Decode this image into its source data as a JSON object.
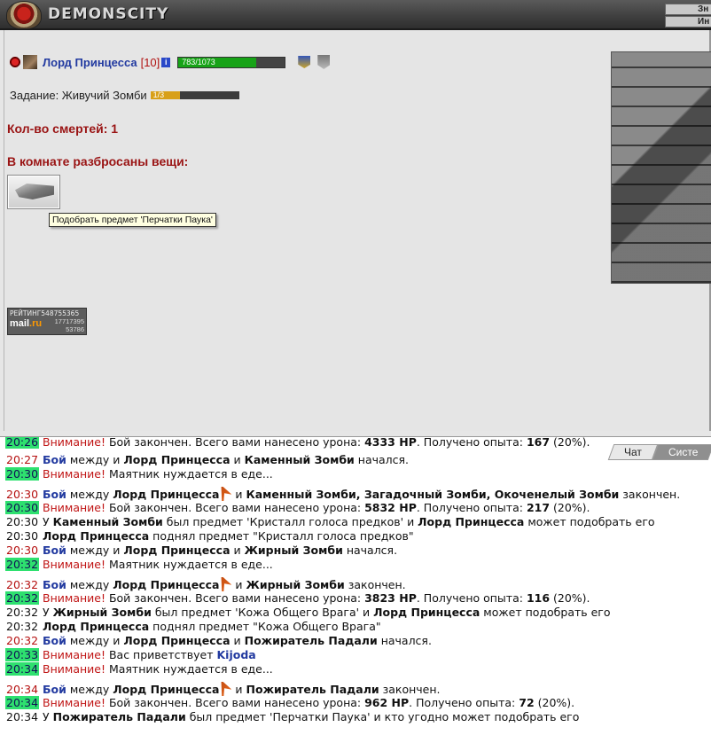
{
  "header": {
    "logo_text": "DEMONSCITY",
    "tabs": [
      "Зн",
      "Ин"
    ]
  },
  "player": {
    "name": "Лорд Принцесса",
    "level": "[10]",
    "info_label": "i",
    "hp_text": "783/1073",
    "hp_fraction": 0.73
  },
  "quest": {
    "label": "Задание: Живучий Зомби",
    "progress_text": "1/3",
    "progress_fraction": 0.333
  },
  "deaths": "Кол-во смертей: 1",
  "items_heading": "В комнате разбросаны вещи:",
  "tooltip": "Подобрать предмет 'Перчатки Паука'",
  "counter": {
    "label": "РЕЙТИНГ",
    "num1": "548755365",
    "num2": "17717395",
    "num3": "53786",
    "brand": "mail",
    "brand_suffix": ".ru"
  },
  "chat_tabs": [
    "Чат",
    "Систе"
  ],
  "log": [
    {
      "time": "20:26",
      "parts": [
        {
          "t": "Внимание!",
          "c": "attn"
        },
        {
          "t": " Бой закончен. Всего вами нанесено урона: ",
          "c": ""
        },
        {
          "t": "4333 HP",
          "c": "b"
        },
        {
          "t": ". Получено опыта: ",
          "c": ""
        },
        {
          "t": "167",
          "c": "b"
        },
        {
          "t": " (20%).",
          "c": ""
        }
      ]
    },
    {
      "time": "20:27",
      "parts": [
        {
          "t": "Бой",
          "c": "blue"
        },
        {
          "t": " между и ",
          "c": ""
        },
        {
          "t": "Лорд Принцесса",
          "c": "b"
        },
        {
          "t": " и ",
          "c": ""
        },
        {
          "t": "Каменный Зомби",
          "c": "b"
        },
        {
          "t": " начался.",
          "c": ""
        }
      ]
    },
    {
      "time": "20:30",
      "parts": [
        {
          "t": "Внимание!",
          "c": "attn"
        },
        {
          "t": " Маятник нуждается в еде...",
          "c": ""
        }
      ]
    },
    {
      "time": "20:30",
      "parts": [
        {
          "t": "Бой",
          "c": "blue"
        },
        {
          "t": " между ",
          "c": ""
        },
        {
          "t": "Лорд Принцесса",
          "c": "b"
        },
        {
          "t": "",
          "c": "flag"
        },
        {
          "t": " и ",
          "c": ""
        },
        {
          "t": "Каменный Зомби, Загадочный Зомби, Окоченелый Зомби",
          "c": "b"
        },
        {
          "t": " закончен.",
          "c": ""
        }
      ]
    },
    {
      "time": "20:30",
      "parts": [
        {
          "t": "Внимание!",
          "c": "attn"
        },
        {
          "t": " Бой закончен. Всего вами нанесено урона: ",
          "c": ""
        },
        {
          "t": "5832 HP",
          "c": "b"
        },
        {
          "t": ". Получено опыта: ",
          "c": ""
        },
        {
          "t": "217",
          "c": "b"
        },
        {
          "t": " (20%).",
          "c": ""
        }
      ]
    },
    {
      "time": "20:30",
      "parts": [
        {
          "t": "У ",
          "c": ""
        },
        {
          "t": "Каменный Зомби",
          "c": "b"
        },
        {
          "t": " был предмет 'Кристалл голоса предков' и ",
          "c": ""
        },
        {
          "t": "Лорд Принцесса",
          "c": "b"
        },
        {
          "t": " может подобрать его",
          "c": ""
        }
      ]
    },
    {
      "time": "20:30",
      "parts": [
        {
          "t": "Лорд Принцесса",
          "c": "b"
        },
        {
          "t": " поднял предмет \"Кристалл голоса предков\"",
          "c": ""
        }
      ]
    },
    {
      "time": "20:30",
      "parts": [
        {
          "t": "Бой",
          "c": "blue"
        },
        {
          "t": " между и ",
          "c": ""
        },
        {
          "t": "Лорд Принцесса",
          "c": "b"
        },
        {
          "t": " и ",
          "c": ""
        },
        {
          "t": "Жирный Зомби",
          "c": "b"
        },
        {
          "t": " начался.",
          "c": ""
        }
      ]
    },
    {
      "time": "20:32",
      "parts": [
        {
          "t": "Внимание!",
          "c": "attn"
        },
        {
          "t": " Маятник нуждается в еде...",
          "c": ""
        }
      ]
    },
    {
      "time": "20:32",
      "parts": [
        {
          "t": "Бой",
          "c": "blue"
        },
        {
          "t": " между ",
          "c": ""
        },
        {
          "t": "Лорд Принцесса",
          "c": "b"
        },
        {
          "t": "",
          "c": "flag"
        },
        {
          "t": " и ",
          "c": ""
        },
        {
          "t": "Жирный Зомби",
          "c": "b"
        },
        {
          "t": " закончен.",
          "c": ""
        }
      ]
    },
    {
      "time": "20:32",
      "parts": [
        {
          "t": "Внимание!",
          "c": "attn"
        },
        {
          "t": " Бой закончен. Всего вами нанесено урона: ",
          "c": ""
        },
        {
          "t": "3823 HP",
          "c": "b"
        },
        {
          "t": ". Получено опыта: ",
          "c": ""
        },
        {
          "t": "116",
          "c": "b"
        },
        {
          "t": " (20%).",
          "c": ""
        }
      ]
    },
    {
      "time": "20:32",
      "parts": [
        {
          "t": "У ",
          "c": ""
        },
        {
          "t": "Жирный Зомби",
          "c": "b"
        },
        {
          "t": " был предмет 'Кожа Общего Врага' и ",
          "c": ""
        },
        {
          "t": "Лорд Принцесса",
          "c": "b"
        },
        {
          "t": " может подобрать его",
          "c": ""
        }
      ]
    },
    {
      "time": "20:32",
      "parts": [
        {
          "t": "Лорд Принцесса",
          "c": "b"
        },
        {
          "t": " поднял предмет \"Кожа Общего Врага\"",
          "c": ""
        }
      ]
    },
    {
      "time": "20:32",
      "parts": [
        {
          "t": "Бой",
          "c": "blue"
        },
        {
          "t": " между и ",
          "c": ""
        },
        {
          "t": "Лорд Принцесса",
          "c": "b"
        },
        {
          "t": " и ",
          "c": ""
        },
        {
          "t": "Пожиратель Падали",
          "c": "b"
        },
        {
          "t": " начался.",
          "c": ""
        }
      ]
    },
    {
      "time": "20:33",
      "parts": [
        {
          "t": "Внимание!",
          "c": "attn"
        },
        {
          "t": " Вас приветствует ",
          "c": ""
        },
        {
          "t": "Kijoda",
          "c": "blue"
        }
      ]
    },
    {
      "time": "20:34",
      "parts": [
        {
          "t": "Внимание!",
          "c": "attn"
        },
        {
          "t": " Маятник нуждается в еде...",
          "c": ""
        }
      ]
    },
    {
      "time": "20:34",
      "parts": [
        {
          "t": "Бой",
          "c": "blue"
        },
        {
          "t": " между ",
          "c": ""
        },
        {
          "t": "Лорд Принцесса",
          "c": "b"
        },
        {
          "t": "",
          "c": "flag"
        },
        {
          "t": " и ",
          "c": ""
        },
        {
          "t": "Пожиратель Падали",
          "c": "b"
        },
        {
          "t": " закончен.",
          "c": ""
        }
      ]
    },
    {
      "time": "20:34",
      "parts": [
        {
          "t": "Внимание!",
          "c": "attn"
        },
        {
          "t": " Бой закончен. Всего вами нанесено урона: ",
          "c": ""
        },
        {
          "t": "962 HP",
          "c": "b"
        },
        {
          "t": ". Получено опыта: ",
          "c": ""
        },
        {
          "t": "72",
          "c": "b"
        },
        {
          "t": " (20%).",
          "c": ""
        }
      ]
    },
    {
      "time": "20:34",
      "parts": [
        {
          "t": "У ",
          "c": ""
        },
        {
          "t": "Пожиратель Падали",
          "c": "b"
        },
        {
          "t": " был предмет 'Перчатки Паука' и кто угодно может подобрать его",
          "c": ""
        }
      ]
    }
  ]
}
